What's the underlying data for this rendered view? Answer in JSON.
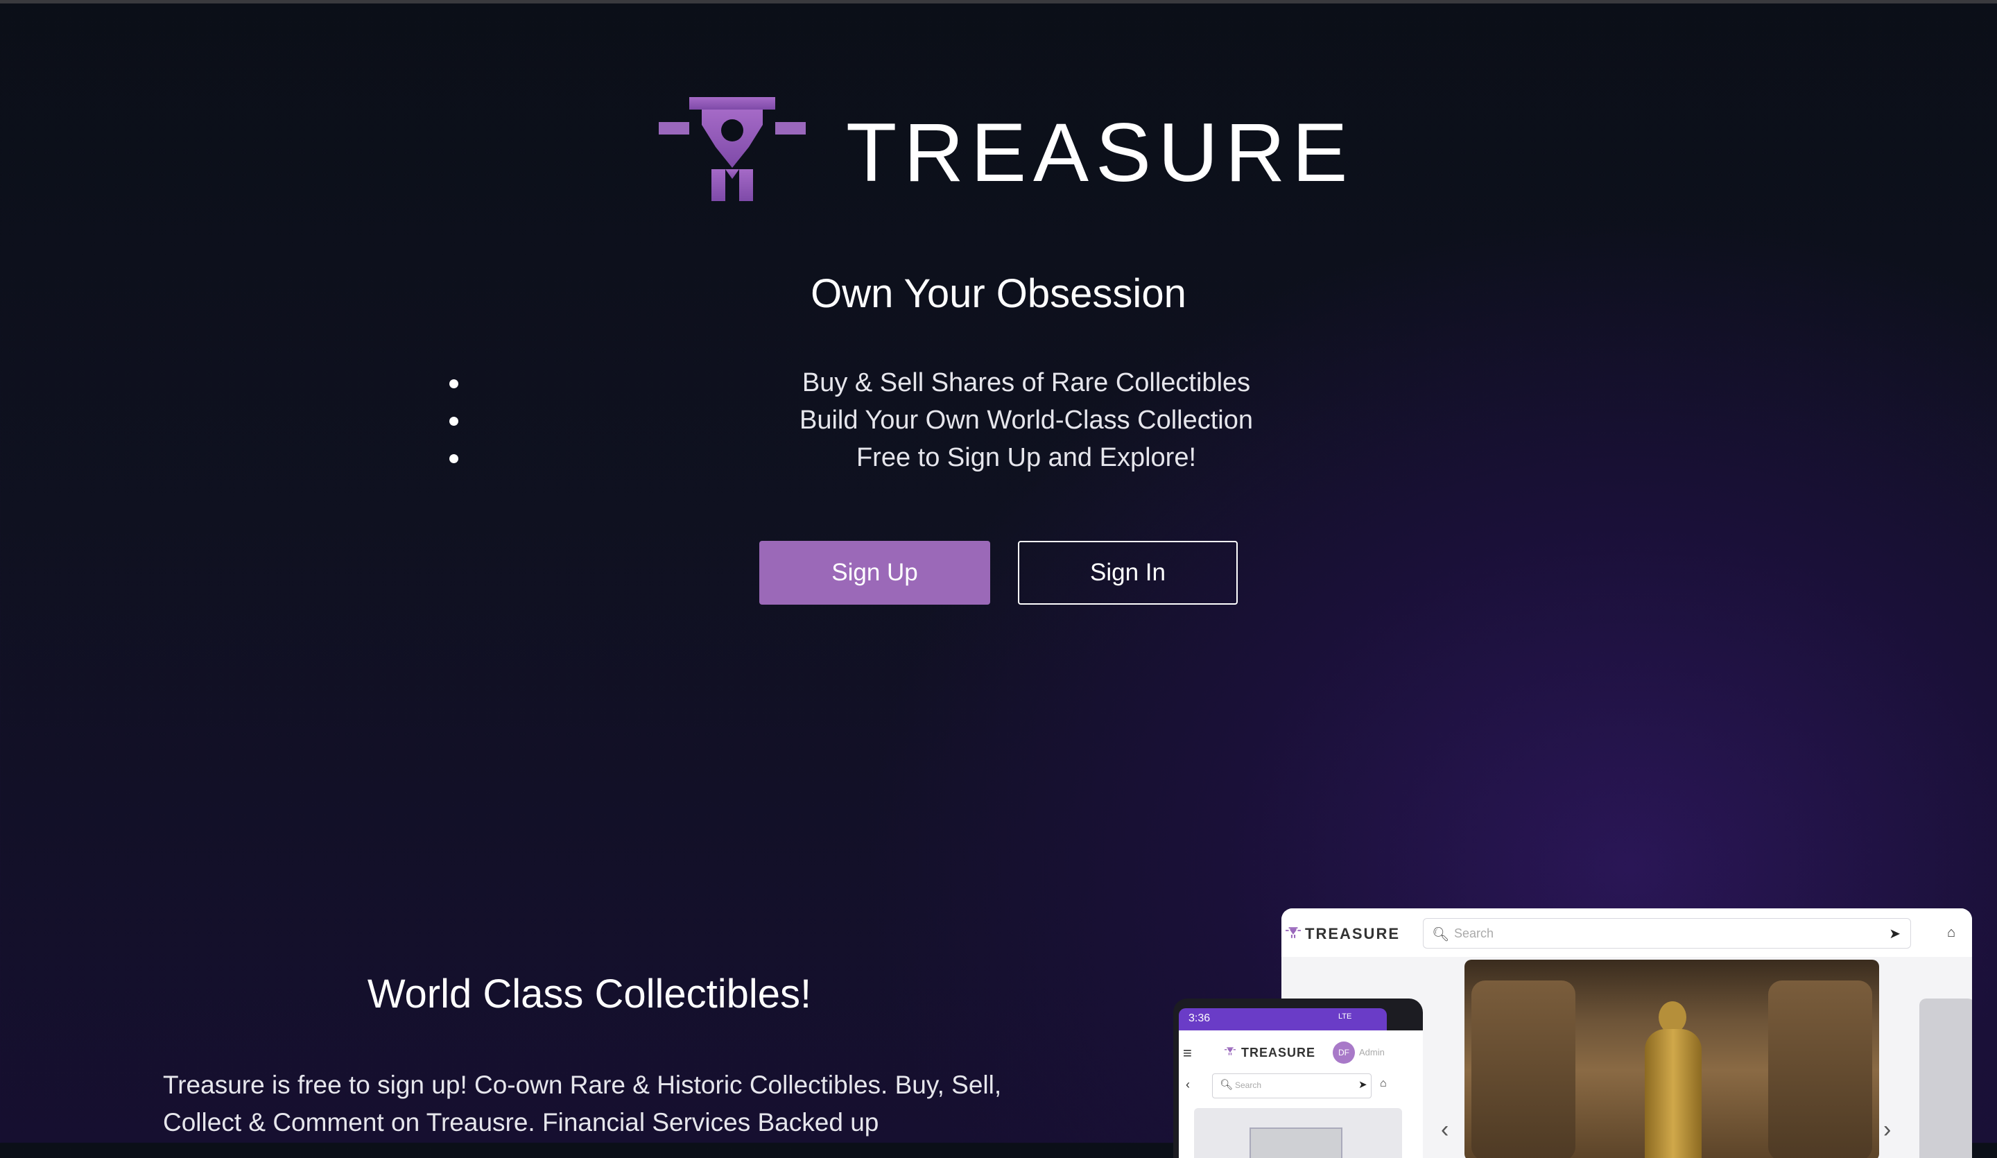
{
  "brand": {
    "name": "TREASURE",
    "accent": "#9b69b8"
  },
  "hero": {
    "tagline": "Own Your Obsession",
    "bullets": [
      "Buy & Sell Shares of Rare Collectibles",
      "Build Your Own World-Class Collection",
      "Free to Sign Up and Explore!"
    ],
    "signup_label": "Sign Up",
    "signin_label": "Sign In"
  },
  "section": {
    "title": "World Class Collectibles!",
    "body": "Treasure is free to sign up! Co-own Rare & Historic Collectibles. Buy, Sell, Collect & Comment on Treausre. Financial Services Backed up"
  },
  "mockup": {
    "desktop": {
      "brand": "TREASURE",
      "search_placeholder": "Search"
    },
    "phone": {
      "time": "3:36",
      "signal": "LTE",
      "brand": "TREASURE",
      "avatar": "DF",
      "admin": "Admin",
      "search_placeholder": "Search"
    }
  }
}
